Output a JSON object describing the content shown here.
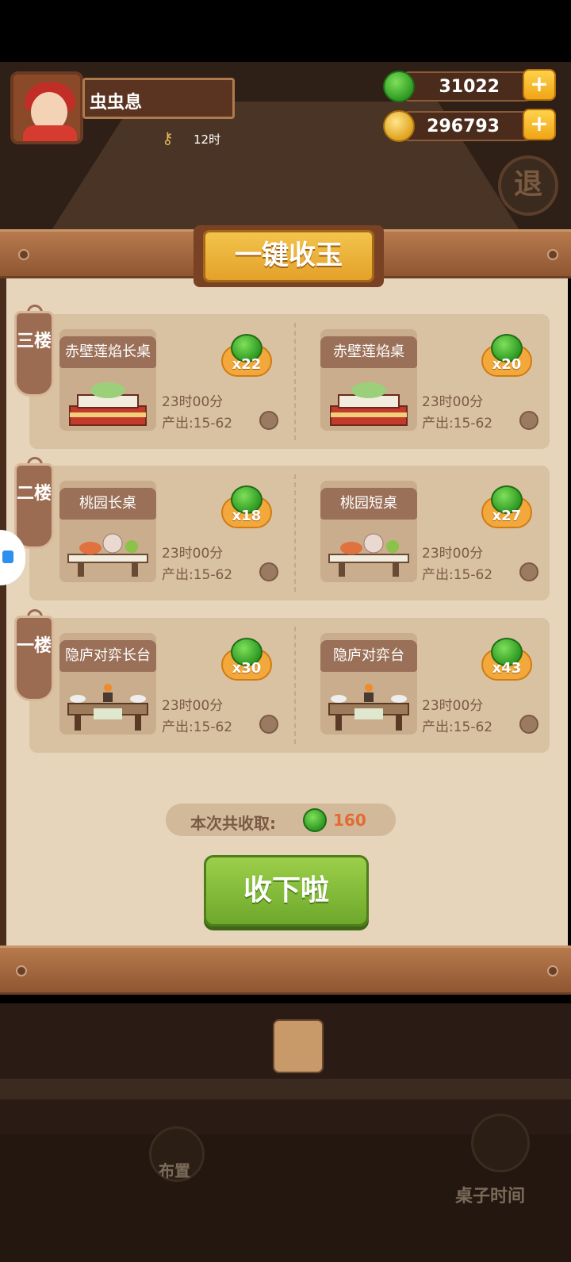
{
  "player": {
    "name": "虫虫息",
    "time_remaining": "12时"
  },
  "currency": {
    "jade": "31022",
    "coins": "296793",
    "plus": "+"
  },
  "exit_label": "退",
  "panel": {
    "title": "一键收玉",
    "floors": [
      {
        "label": "三楼",
        "tables": [
          {
            "name": "赤壁莲焰长桌",
            "multiplier": "x22",
            "duration": "23时00分",
            "output": "产出:15-62"
          },
          {
            "name": "赤壁莲焰桌",
            "multiplier": "x20",
            "duration": "23时00分",
            "output": "产出:15-62"
          }
        ]
      },
      {
        "label": "二楼",
        "tables": [
          {
            "name": "桃园长桌",
            "multiplier": "x18",
            "duration": "23时00分",
            "output": "产出:15-62"
          },
          {
            "name": "桃园短桌",
            "multiplier": "x27",
            "duration": "23时00分",
            "output": "产出:15-62"
          }
        ]
      },
      {
        "label": "一楼",
        "tables": [
          {
            "name": "隐庐对弈长台",
            "multiplier": "x30",
            "duration": "23时00分",
            "output": "产出:15-62"
          },
          {
            "name": "隐庐对弈台",
            "multiplier": "x43",
            "duration": "23时00分",
            "output": "产出:15-62"
          }
        ]
      }
    ],
    "total_label": "本次共收取:",
    "total_value": "160",
    "collect_button": "收下啦"
  },
  "bottom": {
    "layout_label": "布置",
    "table_time_label": "桌子时间"
  },
  "colors": {
    "jade": "#2f9a23",
    "gold": "#e0a420",
    "accent_orange": "#e26b35",
    "button_green": "#6ea82b"
  }
}
